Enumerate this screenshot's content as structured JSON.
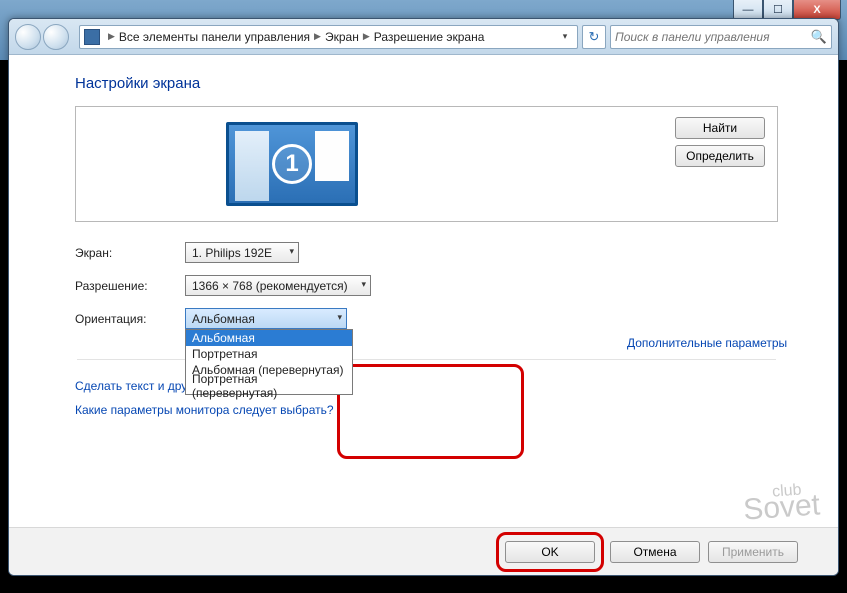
{
  "window_controls": {
    "minimize": "—",
    "maximize": "☐",
    "close": "X"
  },
  "breadcrumb": {
    "root_sep": "▶",
    "items": [
      "Все элементы панели управления",
      "Экран",
      "Разрешение экрана"
    ]
  },
  "search": {
    "placeholder": "Поиск в панели управления"
  },
  "heading": "Настройки экрана",
  "monitor_number": "1",
  "side_buttons": {
    "find": "Найти",
    "identify": "Определить"
  },
  "fields": {
    "display_label": "Экран:",
    "display_value": "1. Philips 192E",
    "resolution_label": "Разрешение:",
    "resolution_value": "1366 × 768 (рекомендуется)",
    "orientation_label": "Ориентация:",
    "orientation_value": "Альбомная",
    "orientation_options": [
      "Альбомная",
      "Портретная",
      "Альбомная (перевернутая)",
      "Портретная (перевернутая)"
    ]
  },
  "links": {
    "advanced": "Дополнительные параметры",
    "text_size": "Сделать текст и другие",
    "which_monitor": "Какие параметры монитора следует выбрать?"
  },
  "buttons": {
    "ok": "OK",
    "cancel": "Отмена",
    "apply": "Применить"
  },
  "watermark": "Sovet"
}
